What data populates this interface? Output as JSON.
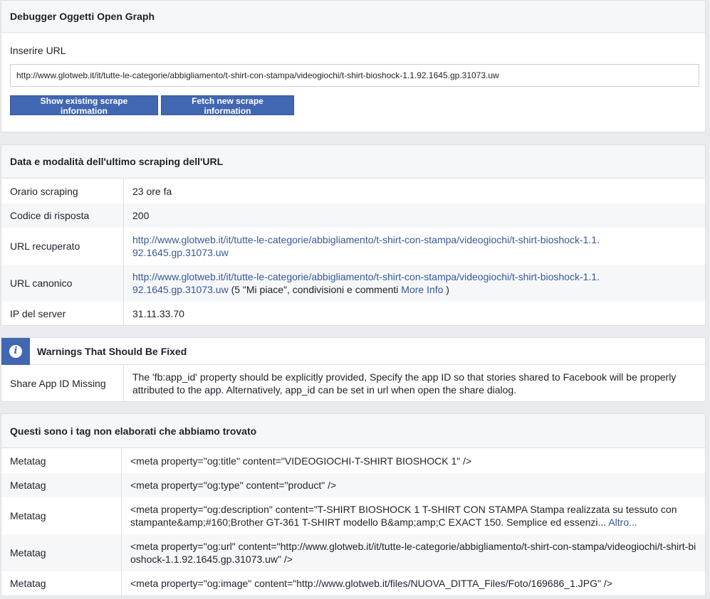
{
  "input_card": {
    "title": "Debugger Oggetti Open Graph",
    "label": "Inserire URL",
    "url_value": "http://www.glotweb.it/it/tutte-le-categorie/abbigliamento/t-shirt-con-stampa/videogiochi/t-shirt-bioshock-1.1.92.1645.gp.31073.uw",
    "btn_existing": "Show existing scrape information",
    "btn_fetch": "Fetch new scrape information"
  },
  "scrape_card": {
    "title": "Data e modalità dell'ultimo scraping dell'URL",
    "rows": [
      {
        "key": "Orario scraping",
        "value": "23 ore fa"
      },
      {
        "key": "Codice di risposta",
        "value": "200"
      },
      {
        "key": "URL recuperato",
        "link": "http://www.glotweb.it/it/tutte-le-categorie/abbigliamento/t-shirt-con-stampa/videogiochi/t-shirt-bioshock-1.1.92.1645.gp.31073.uw"
      },
      {
        "key": "URL canonico",
        "link": "http://www.glotweb.it/it/tutte-le-categorie/abbigliamento/t-shirt-con-stampa/videogiochi/t-shirt-bioshock-1.1.92.1645.gp.31073.uw",
        "suffix": " (5 \"Mi piace\", condivisioni e commenti ",
        "more_link": "More Info",
        "close": " )"
      },
      {
        "key": "IP del server",
        "value": "31.11.33.70"
      }
    ]
  },
  "warnings_card": {
    "title": "Warnings That Should Be Fixed",
    "icon": "info-icon",
    "icon_glyph": "i",
    "rows": [
      {
        "key": "Share App ID Missing",
        "value": "The 'fb:app_id' property should be explicitly provided, Specify the app ID so that stories shared to Facebook will be properly attributed to the app. Alternatively, app_id can be set in url when open the share dialog."
      }
    ]
  },
  "tags_card": {
    "title": "Questi sono i tag non elaborati che abbiamo trovato",
    "rows": [
      {
        "key": "Metatag",
        "value": "<meta property=\"og:title\" content=\"VIDEOGIOCHI-T-SHIRT BIOSHOCK 1\" />"
      },
      {
        "key": "Metatag",
        "value": "<meta property=\"og:type\" content=\"product\" />"
      },
      {
        "key": "Metatag",
        "value": "<meta property=\"og:description\" content=\"T-SHIRT BIOSHOCK 1 T-SHIRT CON STAMPA Stampa realizzata su tessuto con stampante&amp;#160;Brother GT-361 T-SHIRT modello B&amp;amp;C EXACT 150. Semplice ed essenzi...",
        "more_link": "Altro..."
      },
      {
        "key": "Metatag",
        "value": "<meta property=\"og:url\" content=\"http://www.glotweb.it/it/tutte-le-categorie/abbigliamento/t-shirt-con-stampa/videogiochi/t-shirt-bioshock-1.1.92.1645.gp.31073.uw\" />"
      },
      {
        "key": "Metatag",
        "value": "<meta property=\"og:image\" content=\"http://www.glotweb.it/files/NUOVA_DITTA_Files/Foto/169686_1.JPG\" />"
      }
    ]
  },
  "colors": {
    "accent": "#4267b2",
    "link": "#365899",
    "background": "#e9ebee",
    "header_bg": "#f6f7f9",
    "border": "#dddfe2"
  }
}
